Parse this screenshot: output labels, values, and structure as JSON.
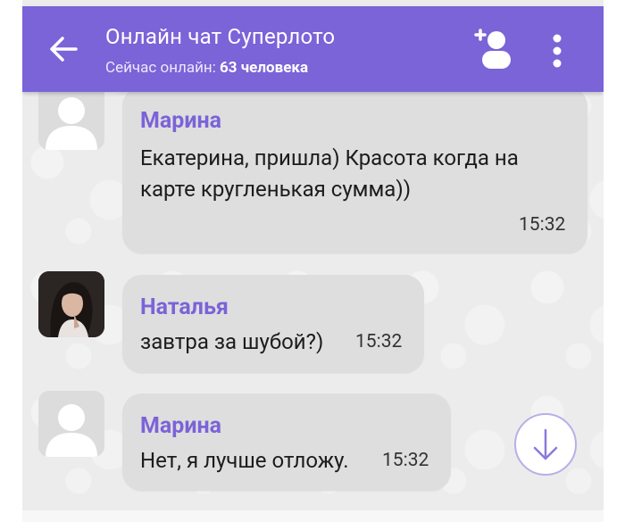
{
  "header": {
    "title": "Онлайн чат Суперлото",
    "online_label": "Сейчас онлайн: ",
    "online_count": "63 человека",
    "back_icon": "arrow-left-icon",
    "add_user_icon": "add-user-icon",
    "menu_icon": "more-vertical-icon"
  },
  "messages": [
    {
      "author": "Марина",
      "text_lines": [
        "Екатерина, пришла) Красота когда на",
        "карте кругленькая сумма))"
      ],
      "time": "15:32",
      "avatar": "default-avatar"
    },
    {
      "author": "Наталья",
      "text_lines": [
        "завтра за шубой?)"
      ],
      "time": "15:32",
      "avatar": "photo-avatar"
    },
    {
      "author": "Марина",
      "text_lines": [
        "Нет, я лучше отложу."
      ],
      "time": "15:32",
      "avatar": "default-avatar"
    }
  ],
  "scroll_button": {
    "icon": "arrow-down-icon"
  },
  "colors": {
    "accent": "#7b63d8",
    "bubble": "#dedede",
    "background": "#ececec"
  }
}
